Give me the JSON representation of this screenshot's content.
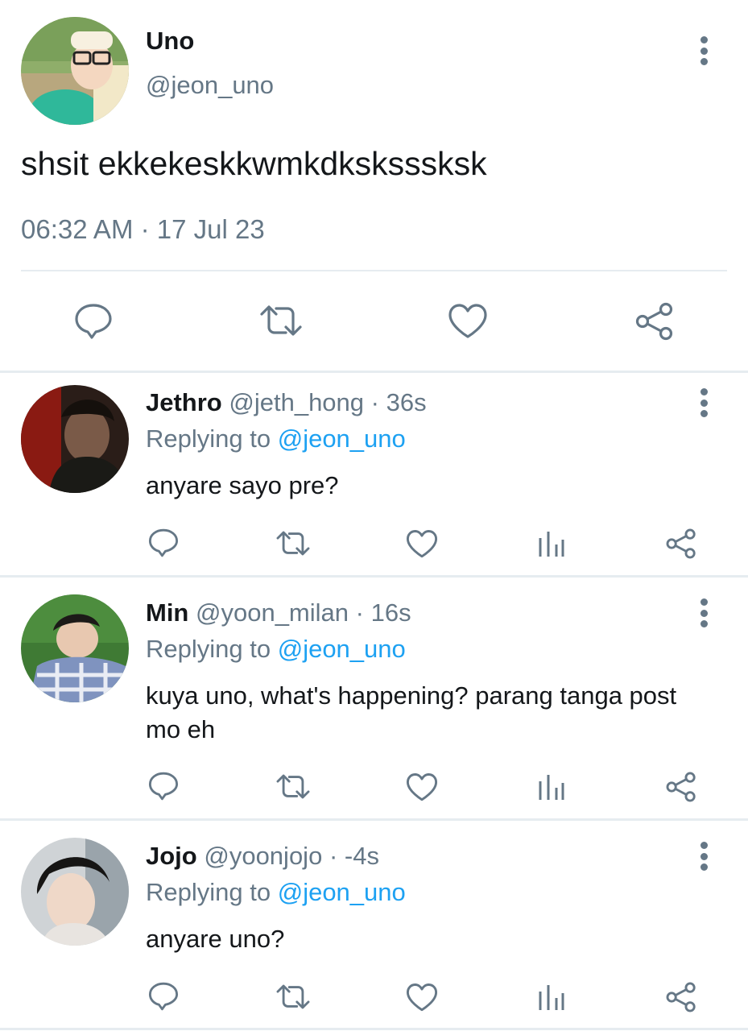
{
  "main_tweet": {
    "name": "Uno",
    "handle": "@jeon_uno",
    "text": "shsit ekkekeskkwmkdksksssksk",
    "time": "06:32 AM",
    "date": "17 Jul 23",
    "separator": "·"
  },
  "actions": [
    "reply-icon",
    "retweet-icon",
    "like-icon",
    "share-icon"
  ],
  "replies": [
    {
      "name": "Jethro",
      "handle": "@jeth_hong",
      "time": "36s",
      "replying_prefix": "Replying to",
      "replying_to": "@jeon_uno",
      "text": "anyare sayo pre?"
    },
    {
      "name": "Min",
      "handle": "@yoon_milan",
      "time": "16s",
      "replying_prefix": "Replying to",
      "replying_to": "@jeon_uno",
      "text": "kuya uno, what's happening? parang tanga post mo eh"
    },
    {
      "name": "Jojo",
      "handle": "@yoonjojo",
      "time": "-4s",
      "replying_prefix": "Replying to",
      "replying_to": "@jeon_uno",
      "text": "anyare uno?"
    }
  ],
  "reply_actions": [
    "reply-icon",
    "retweet-icon",
    "like-icon",
    "views-icon",
    "share-icon"
  ],
  "colors": {
    "text": "#14171a",
    "secondary": "#657786",
    "accent": "#1da1f2",
    "divider": "#e6ecf0"
  }
}
